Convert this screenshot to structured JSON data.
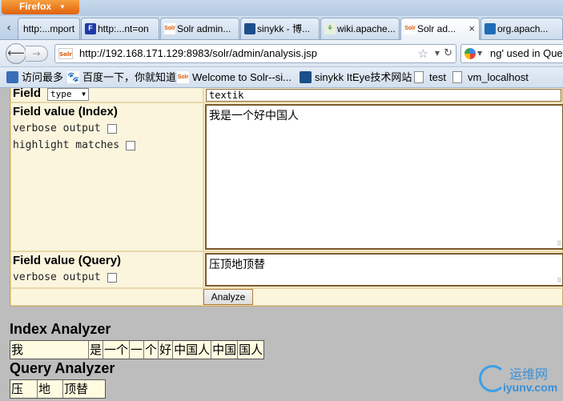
{
  "browser": {
    "menu_button": "Firefox",
    "tabs": [
      {
        "label": "http:...mport",
        "icon": "page-icon"
      },
      {
        "label": "http:...nt=on",
        "icon": "firebug-icon"
      },
      {
        "label": "Solr admin...",
        "icon": "solr-icon"
      },
      {
        "label": "sinykk - 博...",
        "icon": "cnblogs-icon"
      },
      {
        "label": "wiki.apache...",
        "icon": "wiki-icon"
      },
      {
        "label": "Solr ad...",
        "icon": "solr-icon",
        "active": true
      },
      {
        "label": "org.apach...",
        "icon": "google-icon"
      }
    ],
    "tab_close": "×",
    "url": "http://192.168.171.129:8983/solr/admin/analysis.jsp",
    "search_text": "ng' used in Quer",
    "bookmarks": [
      {
        "label": "访问最多",
        "icon": "folder-icon"
      },
      {
        "label": "百度一下，你就知道",
        "icon": "baidu-paw-icon"
      },
      {
        "label": "Welcome to Solr--si...",
        "icon": "solr-icon"
      },
      {
        "label": "sinykk ItEye技术网站",
        "icon": "iteye-icon"
      },
      {
        "label": "test",
        "icon": "page-icon"
      },
      {
        "label": "vm_localhost",
        "icon": "page-icon"
      }
    ]
  },
  "form": {
    "field_label": "Field",
    "field_type_select": "type",
    "field_name_value": "textik",
    "index_label": "Field value (Index)",
    "verbose_label": "verbose output",
    "highlight_label": "highlight matches",
    "index_value": "我是一个好中国人",
    "query_label": "Field value (Query)",
    "query_verbose_label": "verbose output",
    "query_value": "压顶地顶替",
    "analyze_button": "Analyze"
  },
  "index_analyzer": {
    "title": "Index Analyzer",
    "tokens": [
      "我",
      "是",
      "一个",
      "一",
      "个",
      "好",
      "中国人",
      "中国",
      "国人"
    ]
  },
  "query_analyzer": {
    "title": "Query Analyzer",
    "tokens": [
      "压",
      "地",
      "顶替"
    ]
  },
  "watermark": {
    "line1": "运维网",
    "line2": "iyunv.com"
  }
}
